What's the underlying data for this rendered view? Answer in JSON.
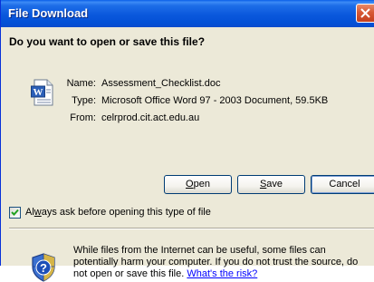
{
  "window": {
    "title": "File Download"
  },
  "dialog": {
    "question": "Do you want to open or save this file?",
    "file_icon": "word-document-icon",
    "info": [
      {
        "label": "Name:",
        "value": "Assessment_Checklist.doc"
      },
      {
        "label": "Type:",
        "value": "Microsoft Office Word 97 - 2003 Document, 59.5KB"
      },
      {
        "label": "From:",
        "value": "celrprod.cit.act.edu.au"
      }
    ],
    "buttons": {
      "open_mnemonic": "O",
      "open_rest": "pen",
      "save_mnemonic": "S",
      "save_rest": "ave",
      "cancel": "Cancel"
    },
    "checkbox": {
      "checked": true,
      "pre": "Al",
      "mnemonic": "w",
      "post": "ays ask before opening this type of file"
    },
    "warning": {
      "icon": "shield-question-icon",
      "text": "While files from the Internet can be useful, some files can potentially harm your computer. If you do not trust the source, do not open or save this file.",
      "link": "What's the risk?"
    }
  },
  "colors": {
    "titlebar": "#0a58dc",
    "dialog_bg": "#ece9d8",
    "close": "#d75a36",
    "link": "#0000ff"
  }
}
